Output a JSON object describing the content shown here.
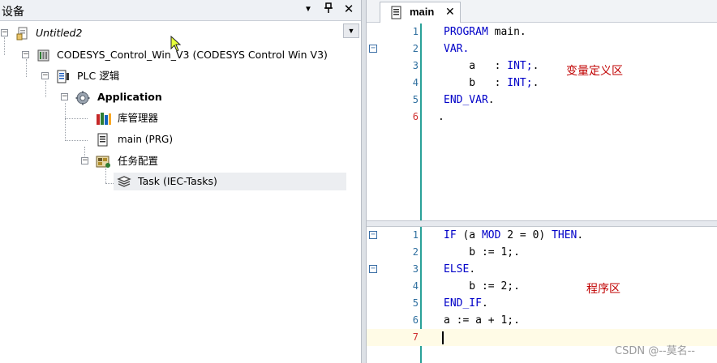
{
  "devices_panel": {
    "title": "设备",
    "dropdown_icon": "chevron-down-icon",
    "pin_icon": "pin-icon",
    "close_icon": "close-icon",
    "tree": [
      {
        "label": "Untitled2",
        "icon": "project-icon"
      },
      {
        "label": "CODESYS_Control_Win_V3 (CODESYS Control Win V3)",
        "icon": "plc-device-icon"
      },
      {
        "label": "PLC 逻辑",
        "icon": "plc-logic-icon"
      },
      {
        "label": "Application",
        "icon": "application-gear-icon"
      },
      {
        "label": "库管理器",
        "icon": "library-manager-icon"
      },
      {
        "label": "main (PRG)",
        "icon": "program-icon"
      },
      {
        "label": "任务配置",
        "icon": "task-config-icon"
      },
      {
        "label": "Task (IEC-Tasks)",
        "icon": "task-icon"
      }
    ]
  },
  "editor": {
    "tab": {
      "label": "main",
      "icon": "pou-document-icon",
      "close": "✕"
    },
    "declaration": {
      "lines": [
        {
          "n": "1",
          "kw": "PROGRAM",
          "rest": " main."
        },
        {
          "n": "2",
          "kw": "VAR.",
          "rest": ""
        },
        {
          "n": "3",
          "kw": "",
          "rest": "    a   : ",
          "kw2": "INT;",
          "rest2": "."
        },
        {
          "n": "4",
          "kw": "",
          "rest": "    b   : ",
          "kw2": "INT;",
          "rest2": "."
        },
        {
          "n": "5",
          "kw": "END_VAR",
          "rest": "."
        },
        {
          "n": "6",
          "kw": "",
          "rest": "."
        }
      ],
      "annotation": "变量定义区"
    },
    "implementation": {
      "lines": [
        {
          "n": "1",
          "text_a": "IF",
          "text_b": " (a ",
          "text_c": "MOD",
          "text_d": " 2 = 0) ",
          "text_e": "THEN",
          "text_f": "."
        },
        {
          "n": "2",
          "text": "    b := 1;."
        },
        {
          "n": "3",
          "kw": "ELSE",
          "rest": "."
        },
        {
          "n": "4",
          "text": "    b := 2;."
        },
        {
          "n": "5",
          "kw": "END_IF",
          "rest": "."
        },
        {
          "n": "6",
          "text": "a := a + 1;."
        },
        {
          "n": "7",
          "text": ""
        }
      ],
      "annotation": "程序区"
    }
  },
  "watermark": "CSDN @--莫名--",
  "colors": {
    "keyword": "#0000c8",
    "line_number": "#2f6f9f",
    "annotation": "#c00000",
    "gutter": "#2aa198"
  }
}
